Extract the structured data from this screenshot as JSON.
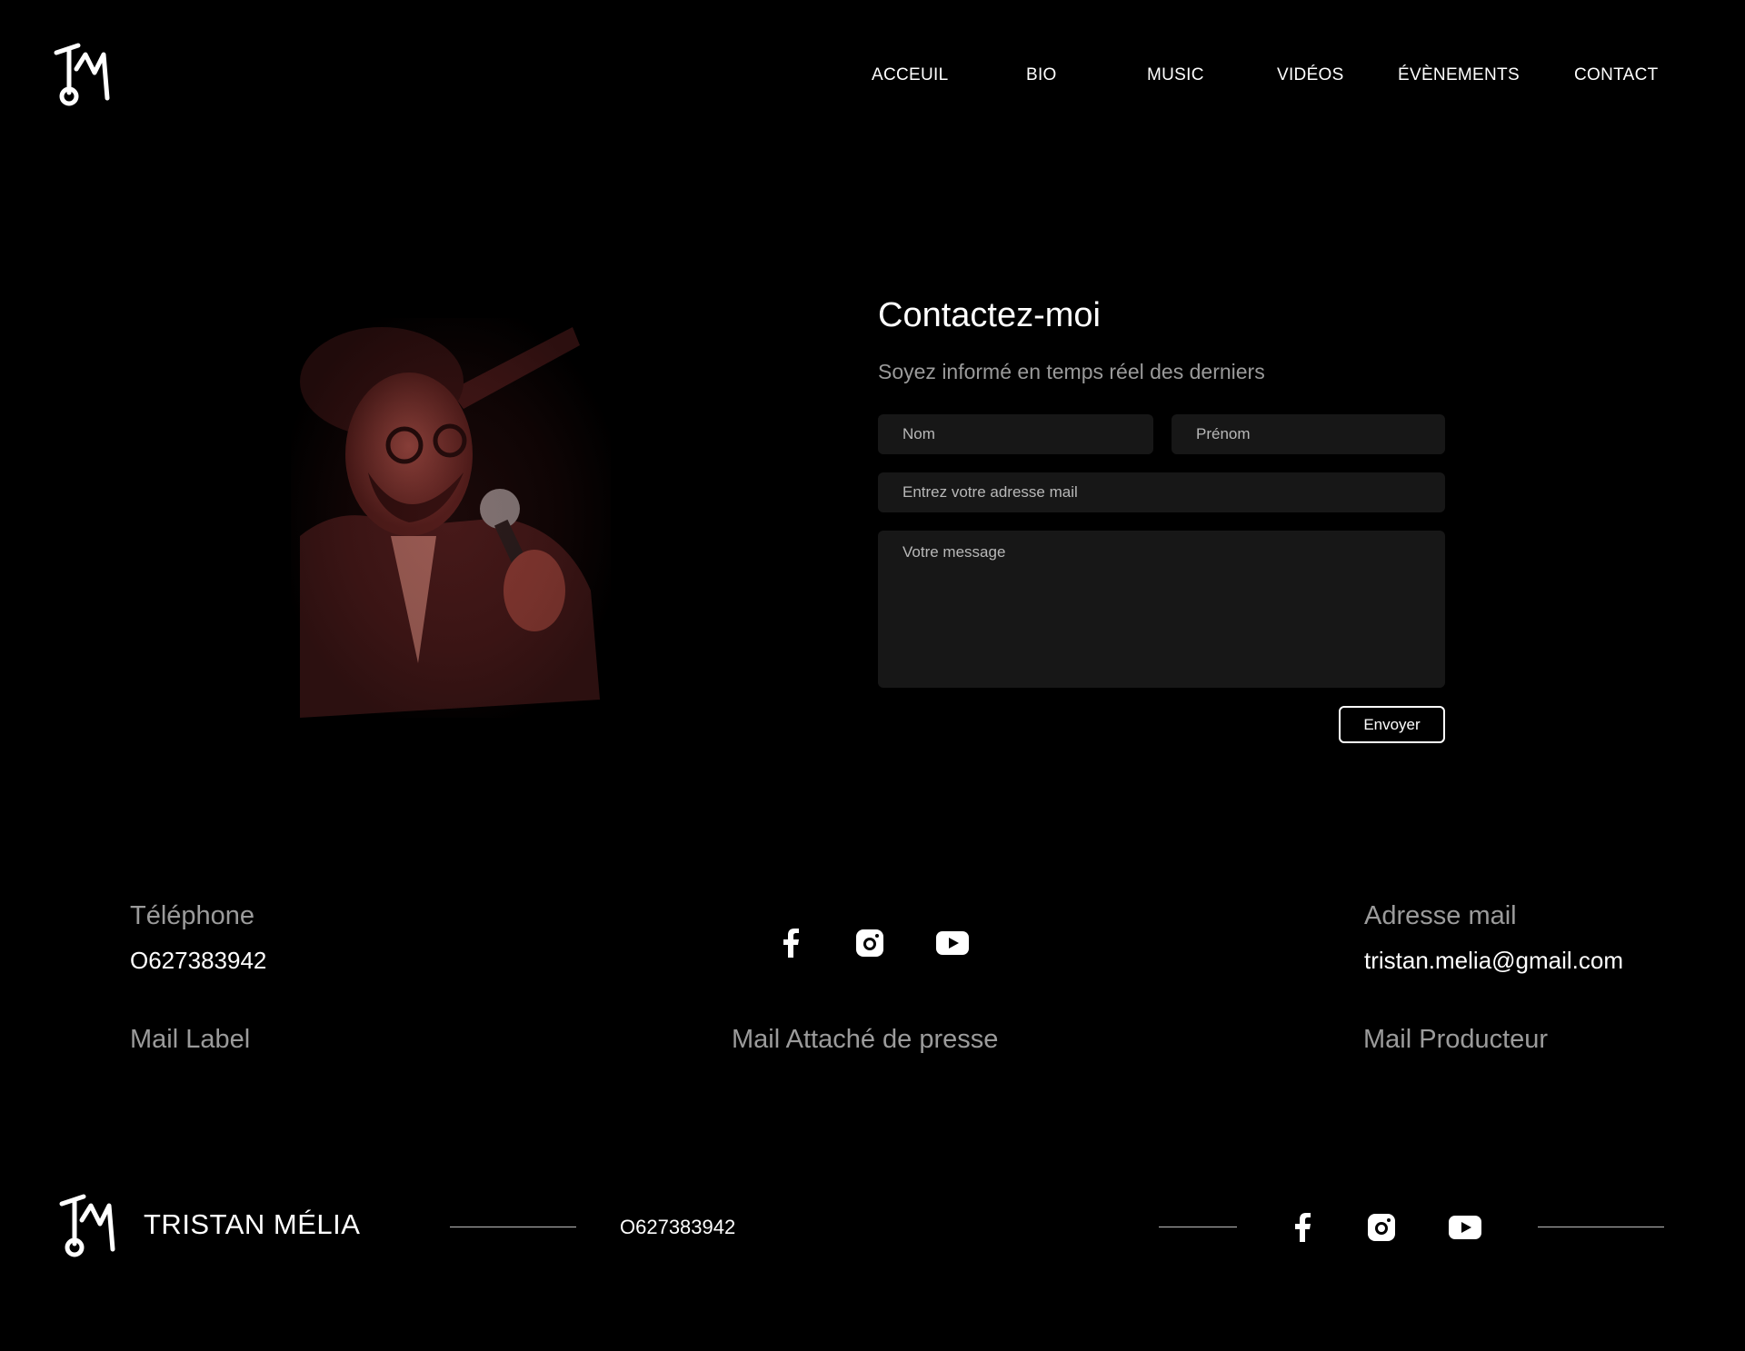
{
  "header": {
    "logo_alt": "TM monogram",
    "nav": [
      {
        "label": "ACCEUIL"
      },
      {
        "label": "BIO"
      },
      {
        "label": "MUSIC"
      },
      {
        "label": "VIDÉOS"
      },
      {
        "label": "ÉVÈNEMENTS"
      },
      {
        "label": "CONTACT"
      }
    ]
  },
  "contact": {
    "title": "Contactez-moi",
    "subtitle": "Soyez informé en temps réel des derniers",
    "fields": {
      "nom_placeholder": "Nom",
      "prenom_placeholder": "Prénom",
      "email_placeholder": "Entrez votre adresse mail",
      "message_placeholder": "Votre message"
    },
    "send_label": "Envoyer"
  },
  "info": {
    "phone_label": "Téléphone",
    "phone_value": "O627383942",
    "email_label": "Adresse mail",
    "email_value": "tristan.melia@gmail.com",
    "mail_label": "Mail Label",
    "mail_press": "Mail Attaché de presse",
    "mail_producer": "Mail Producteur"
  },
  "footer": {
    "name": "TRISTAN MÉLIA",
    "phone": "O627383942"
  },
  "colors": {
    "background": "#000000",
    "field_background": "#171717",
    "muted_text": "#9b9b9b",
    "photo_tint": "#7a2a2a"
  }
}
